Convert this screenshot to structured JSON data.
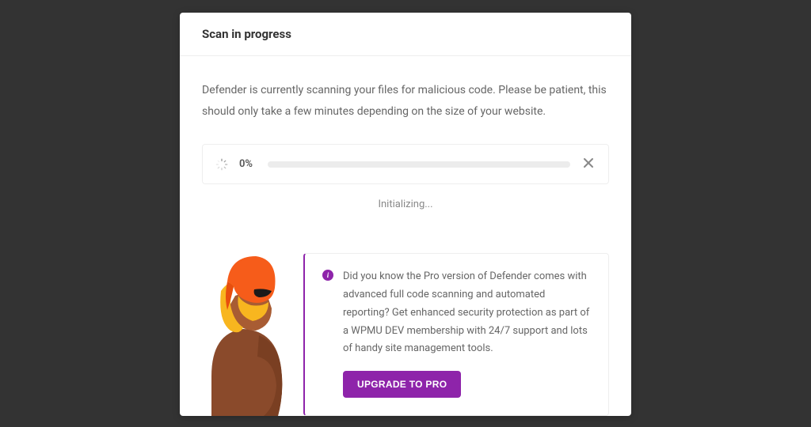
{
  "header": {
    "title": "Scan in progress"
  },
  "body": {
    "description": "Defender is currently scanning your files for malicious code. Please be patient, this should only take a few minutes depending on the size of your website."
  },
  "progress": {
    "percent_label": "0%",
    "status": "Initializing..."
  },
  "promo": {
    "text": "Did you know the Pro version of Defender comes with advanced full code scanning and automated reporting? Get enhanced security protection as part of a WPMU DEV membership with 24/7 support and lots of handy site management tools.",
    "cta_label": "UPGRADE TO PRO"
  },
  "colors": {
    "accent": "#8e24aa"
  }
}
